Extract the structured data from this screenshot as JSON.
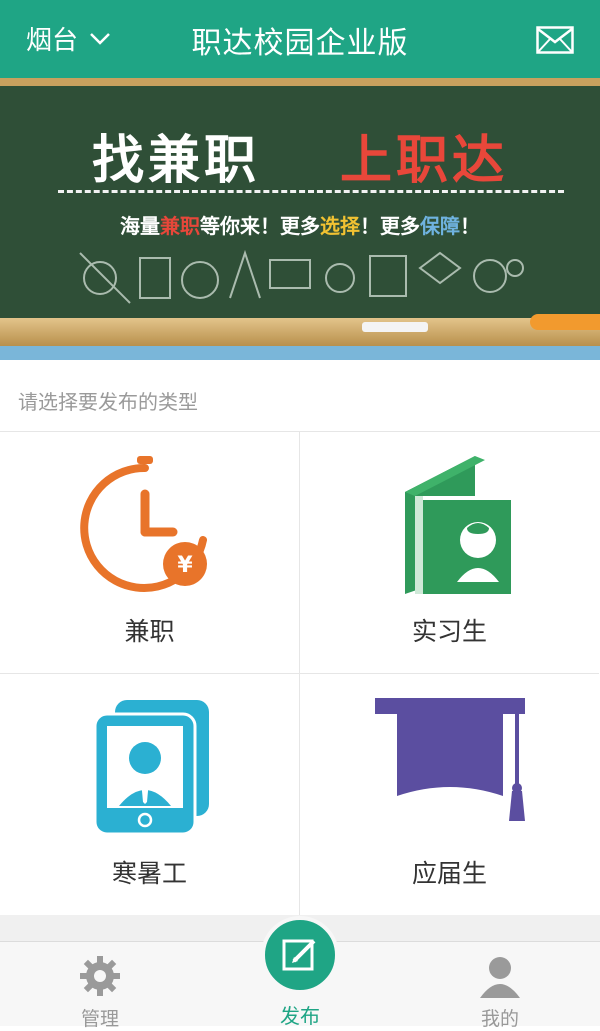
{
  "header": {
    "city": "烟台",
    "title": "职达校园企业版"
  },
  "banner": {
    "slogan_left": "找兼职",
    "slogan_right": "上职达",
    "tagline_parts": [
      "海量",
      "兼职",
      "等你来！更多",
      "选择",
      "！更多",
      "保障",
      "！"
    ]
  },
  "section": {
    "label": "请选择要发布的类型"
  },
  "categories": [
    {
      "label": "兼职",
      "icon": "clock-yuan-icon",
      "color": "#e8742a"
    },
    {
      "label": "实习生",
      "icon": "book-person-icon",
      "color": "#2f9a5a"
    },
    {
      "label": "寒暑工",
      "icon": "tablet-person-icon",
      "color": "#2bb0d2"
    },
    {
      "label": "应届生",
      "icon": "graduation-cap-icon",
      "color": "#5b4ea0"
    }
  ],
  "bottom_nav": {
    "manage": "管理",
    "publish": "发布",
    "mine": "我的"
  },
  "colors": {
    "primary": "#1fa585",
    "board": "#2f4f37",
    "accent_red": "#e8473a"
  }
}
